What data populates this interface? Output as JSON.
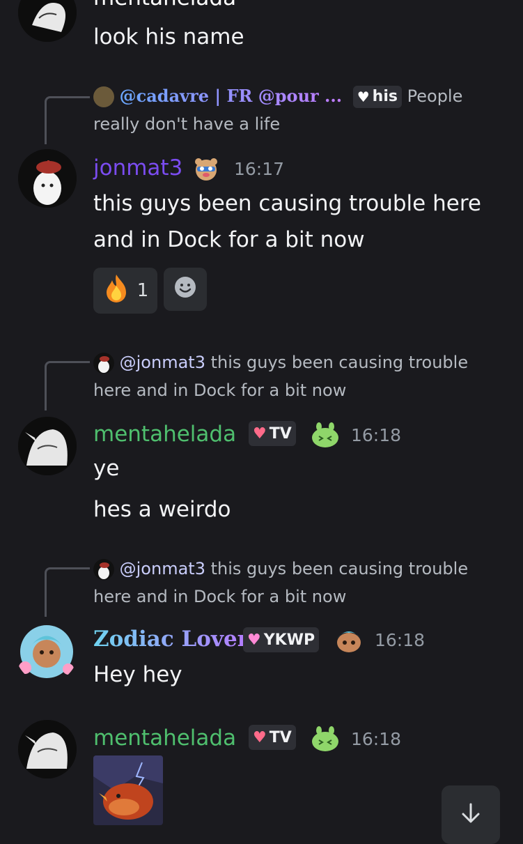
{
  "messages": {
    "top": {
      "username": "mentahelada",
      "text": "look his name"
    },
    "m1": {
      "reply_author": "@cadavre | FR @pour ...",
      "reply_tag": "his",
      "reply_text_1": "People",
      "reply_text_2": "really don't have a life",
      "username": "jonmat3",
      "time": "16:17",
      "line1": "this guys been causing trouble here",
      "line2": "and in Dock for a bit now",
      "reaction_count": "1"
    },
    "m2": {
      "reply_author": "@jonmat3",
      "reply_text_1": "this guys been causing trouble",
      "reply_text_2": "here and in Dock for a bit now",
      "username": "mentahelada",
      "tag": "TV",
      "time": "16:18",
      "line1": "ye",
      "line2": "hes a weirdo"
    },
    "m3": {
      "reply_author": "@jonmat3",
      "reply_text_1": "this guys been causing trouble",
      "reply_text_2": "here and in Dock for a bit now",
      "username": "Zodiac Lover",
      "tag": "YKWP",
      "time": "16:18",
      "line1": "Hey hey"
    },
    "m4": {
      "username": "mentahelada",
      "tag": "TV",
      "time": "16:18"
    }
  },
  "colors": {
    "background": "#1a1a1e",
    "jonmat3": "#7b4cf0",
    "mentahelada": "#4fbf6e",
    "zodiac_gradient": [
      "#6fd3f0",
      "#b57bff"
    ],
    "cadavre_gradient": [
      "#6aa7ff",
      "#c07bff"
    ]
  },
  "icons": {
    "scroll_down": "arrow-down-icon",
    "add_reaction": "smiley-icon",
    "reaction_emoji": "fire-icon"
  }
}
